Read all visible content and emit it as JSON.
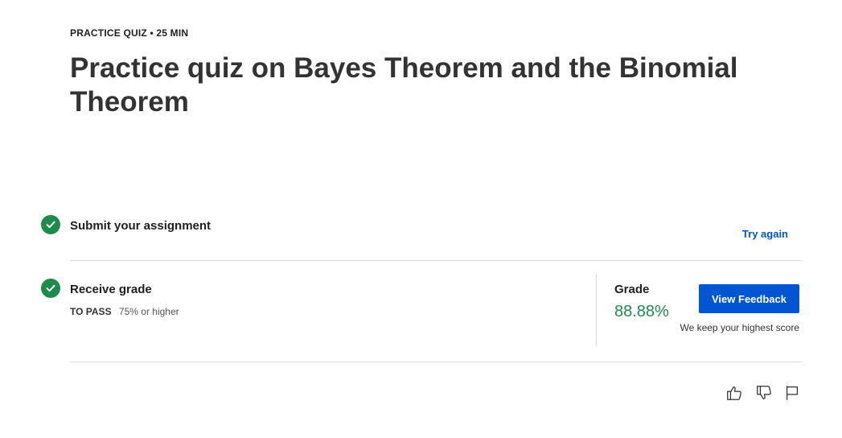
{
  "header": {
    "eyebrow": "PRACTICE QUIZ • 25 MIN",
    "title": "Practice quiz on Bayes Theorem and the Binomial Theorem"
  },
  "steps": {
    "submit": {
      "label": "Submit your assignment",
      "action": "Try again",
      "status_icon": "check-circle-icon"
    },
    "grade": {
      "label": "Receive grade",
      "pass_key": "TO PASS",
      "pass_value": "75% or higher",
      "status_icon": "check-circle-icon"
    }
  },
  "result": {
    "grade_label": "Grade",
    "grade_value": "88.88%",
    "button_label": "View Feedback",
    "note": "We keep your highest score"
  },
  "footer_icons": [
    "thumbs-up-icon",
    "thumbs-down-icon",
    "flag-icon"
  ],
  "colors": {
    "accent": "#0056d2",
    "success": "#1e8a4c"
  }
}
